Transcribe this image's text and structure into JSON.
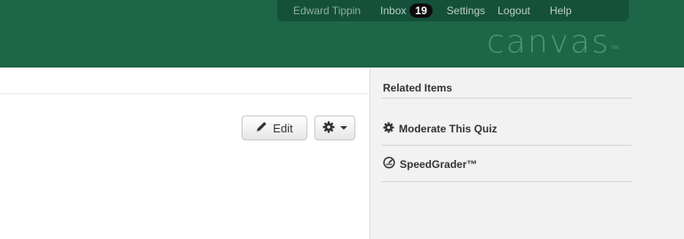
{
  "header": {
    "user_name": "Edward Tippin",
    "inbox_label": "Inbox",
    "inbox_count": "19",
    "settings_label": "Settings",
    "logout_label": "Logout",
    "help_label": "Help",
    "logo_text": "canvas",
    "logo_tm": "™"
  },
  "toolbar": {
    "edit_label": "Edit",
    "edit_icon": "pencil-icon",
    "settings_icon": "gear-icon",
    "dropdown_icon": "caret-down-icon"
  },
  "sidebar": {
    "title": "Related Items",
    "items": [
      {
        "label": "Moderate This Quiz",
        "icon": "gear-icon"
      },
      {
        "label": "SpeedGrader™",
        "icon": "speedometer-icon"
      }
    ]
  },
  "colors": {
    "header_bg": "#1d6648",
    "user_bar_bg": "#14503a",
    "logo": "#4a9a73",
    "sidebar_bg": "#f2f2f2"
  }
}
